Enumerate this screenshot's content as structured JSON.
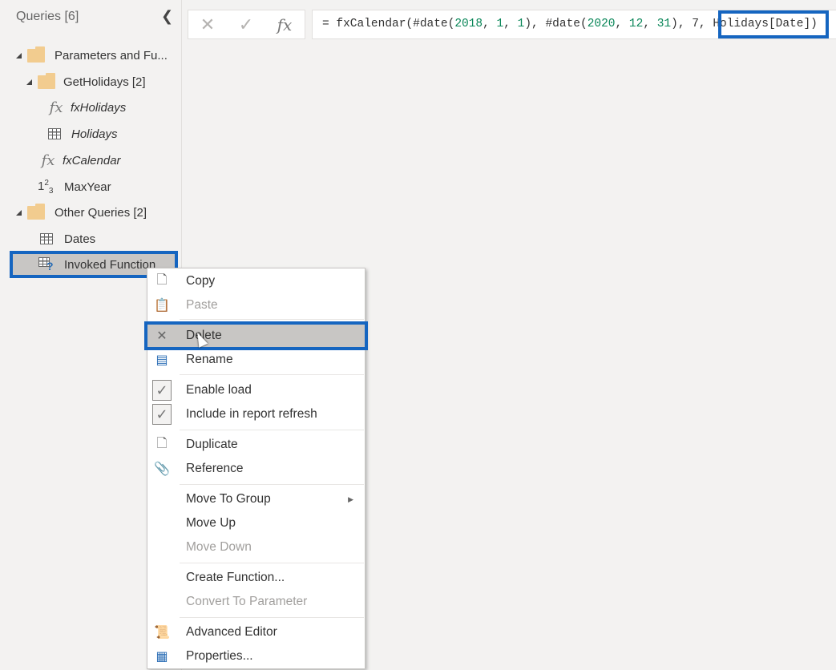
{
  "sidebar": {
    "header": "Queries [6]",
    "collapse_icon": "chevron-left-icon",
    "items": [
      {
        "label": "Parameters and Fu...",
        "type": "folder",
        "icon": "folder-icon",
        "expanded": true
      },
      {
        "label": "GetHolidays [2]",
        "type": "folder",
        "icon": "folder-icon",
        "expanded": true
      },
      {
        "label": "fxHolidays",
        "type": "function",
        "icon": "function-icon"
      },
      {
        "label": "Holidays",
        "type": "table",
        "icon": "table-icon"
      },
      {
        "label": "fxCalendar",
        "type": "function",
        "icon": "function-icon"
      },
      {
        "label": "MaxYear",
        "type": "parameter",
        "icon": "number-icon"
      },
      {
        "label": "Other Queries [2]",
        "type": "folder",
        "icon": "folder-icon",
        "expanded": true
      },
      {
        "label": "Dates",
        "type": "table",
        "icon": "table-icon"
      },
      {
        "label": "Invoked Function",
        "type": "table",
        "icon": "invoked-table-icon",
        "selected": true
      }
    ]
  },
  "formula_bar": {
    "cancel_icon": "close-icon",
    "commit_icon": "check-icon",
    "fx_label": "fx",
    "parts": [
      {
        "text": "= fxCalendar(#date(",
        "kind": "code"
      },
      {
        "text": "2018",
        "kind": "num"
      },
      {
        "text": ", ",
        "kind": "code"
      },
      {
        "text": "1",
        "kind": "num"
      },
      {
        "text": ", ",
        "kind": "code"
      },
      {
        "text": "1",
        "kind": "num"
      },
      {
        "text": "), #date(",
        "kind": "code"
      },
      {
        "text": "2020",
        "kind": "num"
      },
      {
        "text": ", ",
        "kind": "code"
      },
      {
        "text": "12",
        "kind": "num"
      },
      {
        "text": ", ",
        "kind": "code"
      },
      {
        "text": "31",
        "kind": "num"
      },
      {
        "text": "), 7, ",
        "kind": "code"
      },
      {
        "text": "Holidays[Date]",
        "kind": "code",
        "highlighted": true
      },
      {
        "text": ")",
        "kind": "code"
      }
    ]
  },
  "context_menu": {
    "items": [
      {
        "label": "Copy",
        "icon": "copy-icon",
        "enabled": true
      },
      {
        "label": "Paste",
        "icon": "paste-icon",
        "enabled": false
      },
      {
        "label": "Delete",
        "icon": "delete-icon",
        "enabled": true,
        "hovered": true
      },
      {
        "label": "Rename",
        "icon": "rename-icon",
        "enabled": true
      },
      {
        "label": "Enable load",
        "icon": "checkbox-checked-icon",
        "enabled": true,
        "checked": true
      },
      {
        "label": "Include in report refresh",
        "icon": "checkbox-checked-icon",
        "enabled": true,
        "checked": true
      },
      {
        "label": "Duplicate",
        "icon": "duplicate-icon",
        "enabled": true
      },
      {
        "label": "Reference",
        "icon": "paperclip-icon",
        "enabled": true
      },
      {
        "label": "Move To Group",
        "icon": "",
        "enabled": true,
        "submenu": true
      },
      {
        "label": "Move Up",
        "icon": "",
        "enabled": true
      },
      {
        "label": "Move Down",
        "icon": "",
        "enabled": false
      },
      {
        "label": "Create Function...",
        "icon": "",
        "enabled": true
      },
      {
        "label": "Convert To Parameter",
        "icon": "",
        "enabled": false
      },
      {
        "label": "Advanced Editor",
        "icon": "advanced-editor-icon",
        "enabled": true
      },
      {
        "label": "Properties...",
        "icon": "properties-icon",
        "enabled": true
      }
    ]
  },
  "colors": {
    "highlight": "#1565c0",
    "number": "#098658",
    "folder": "#f2cc8f",
    "hover": "#c8c6c4"
  }
}
